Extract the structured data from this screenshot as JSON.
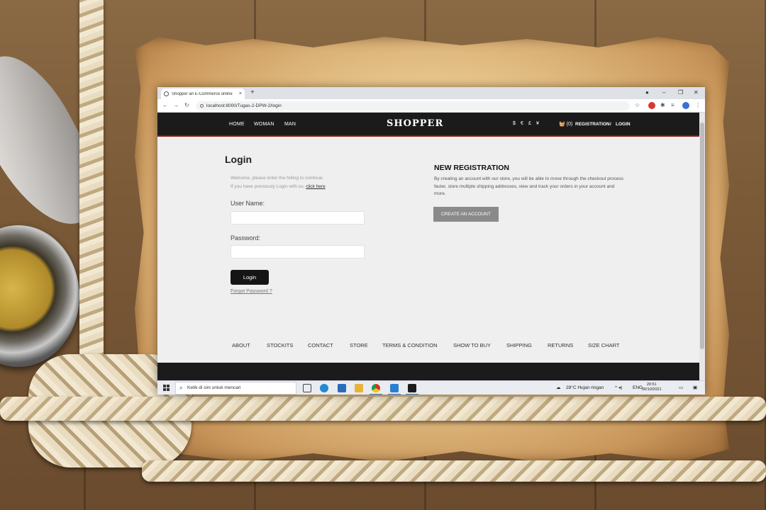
{
  "browser": {
    "tab_title": "Shopper an E-Commerce online",
    "tab_close": "×",
    "new_tab": "+",
    "url": "localhost:8000/Tugas-2-DPW-2/login",
    "window_controls": [
      "–",
      "❐",
      "✕"
    ]
  },
  "site": {
    "nav": [
      "HOME",
      "WOMAN",
      "MAN"
    ],
    "logo": "SHOPPER",
    "currencies": [
      "$",
      "€",
      "£",
      "¥"
    ],
    "cart": "(0)",
    "registration": "REGISTRATION",
    "separator": "/",
    "login_link": "LOGIN"
  },
  "login": {
    "title": "Login",
    "welcome_line1": "Welcome, please enter the folling to continue.",
    "welcome_line2": "If you have previously Login with us,",
    "click_here": "click here",
    "username_label": "User Name:",
    "password_label": "Password:",
    "button": "Login",
    "forgot": "Forgot Password ?"
  },
  "registration": {
    "title": "NEW REGISTRATION",
    "text": "By creating an account with our store, you will be able to move through the checkout process faster, store multiple shipping addresses, view and track your orders in your account and more.",
    "button": "CREATE AN ACCOUNT"
  },
  "footer_links": [
    "ABOUT",
    "STOCKITS",
    "CONTACT",
    "STORE",
    "TERMS & CONDITION",
    "SHOW TO BUY",
    "SHIPPING",
    "RETURNS",
    "SIZE CHART"
  ],
  "taskbar": {
    "search_placeholder": "Ketik di sini untuk mencari",
    "weather": "28°C  Hujan ringan",
    "lang": "ENG",
    "time": "20:51",
    "date": "06/10/2021"
  },
  "colors": {
    "header_bg": "#1b1b1b",
    "header_accent": "#8e1b1b",
    "create_button": "#8a8a8a"
  }
}
